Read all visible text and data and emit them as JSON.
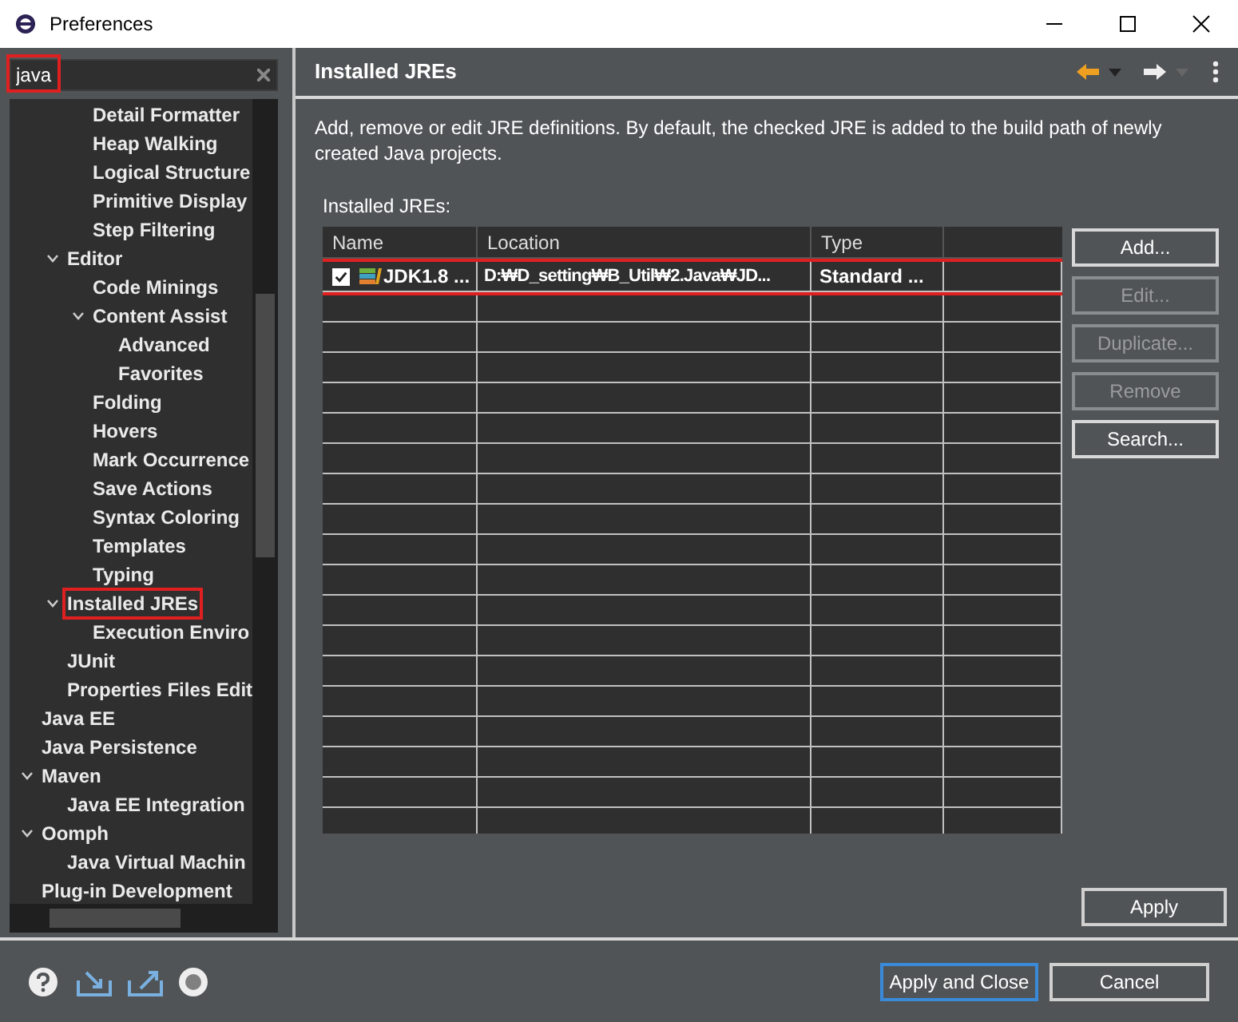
{
  "window": {
    "title": "Preferences"
  },
  "search": {
    "value": "java",
    "highlighted": true
  },
  "tree": {
    "items": [
      {
        "children": [
          {
            "children": [
              {
                "label": "Detail Formatter"
              },
              {
                "label": "Heap Walking"
              },
              {
                "label": "Logical Structure"
              },
              {
                "label": "Primitive Display"
              },
              {
                "label": "Step Filtering"
              }
            ]
          },
          {
            "label": "Editor",
            "expanded": true,
            "children": [
              {
                "label": "Code Minings"
              },
              {
                "label": "Content Assist",
                "expanded": true,
                "children": [
                  {
                    "label": "Advanced"
                  },
                  {
                    "label": "Favorites"
                  }
                ]
              },
              {
                "label": "Folding"
              },
              {
                "label": "Hovers"
              },
              {
                "label": "Mark Occurrence"
              },
              {
                "label": "Save Actions"
              },
              {
                "label": "Syntax Coloring"
              },
              {
                "label": "Templates"
              },
              {
                "label": "Typing"
              }
            ]
          },
          {
            "label": "Installed JREs",
            "expanded": true,
            "highlighted": true,
            "children": [
              {
                "label": "Execution Enviro"
              }
            ]
          },
          {
            "label": "JUnit"
          },
          {
            "label": "Properties Files Edit"
          }
        ]
      },
      {
        "label": "Java EE"
      },
      {
        "label": "Java Persistence"
      },
      {
        "label": "Maven",
        "expanded": true,
        "children": [
          {
            "label": "Java EE Integration"
          }
        ]
      },
      {
        "label": "Oomph",
        "expanded": true,
        "children": [
          {
            "label": "Java Virtual Machin"
          }
        ]
      },
      {
        "label": "Plug-in Development"
      }
    ]
  },
  "page": {
    "title": "Installed JREs",
    "description": "Add, remove or edit JRE definitions. By default, the checked JRE is added to the build path of newly created Java projects.",
    "list_label": "Installed JREs:"
  },
  "table": {
    "columns": [
      "Name",
      "Location",
      "Type"
    ],
    "rows": [
      {
        "checked": true,
        "highlighted": true,
        "name": "JDK1.8 ...",
        "location": "D:₩D_setting₩B_Util₩2.Java₩JD...",
        "type": "Standard ..."
      }
    ]
  },
  "side_buttons": [
    {
      "label": "Add...",
      "disabled": false
    },
    {
      "label": "Edit...",
      "disabled": true
    },
    {
      "label": "Duplicate...",
      "disabled": true
    },
    {
      "label": "Remove",
      "disabled": true
    },
    {
      "label": "Search...",
      "disabled": false
    }
  ],
  "apply_button": "Apply",
  "footer_buttons": [
    {
      "label": "Apply and Close",
      "focused": true
    },
    {
      "label": "Cancel",
      "focused": false
    }
  ]
}
